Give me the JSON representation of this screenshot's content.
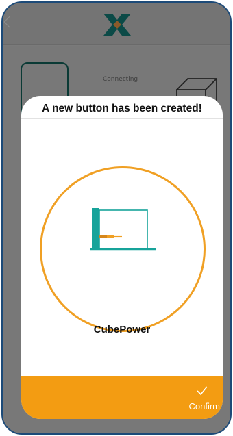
{
  "background": {
    "connecting_text": "Connecting"
  },
  "modal": {
    "title": "A new button has been created!",
    "device_name": "CubePower",
    "confirm_label": "Confirm"
  },
  "colors": {
    "accent": "#f39c12",
    "teal": "#17a39a",
    "frame": "#1c4a78"
  },
  "icons": {
    "logo": "x-brand-logo-icon",
    "back": "chevron-left-icon",
    "device": "cube-device-icon",
    "confirm": "checkmark-icon"
  }
}
